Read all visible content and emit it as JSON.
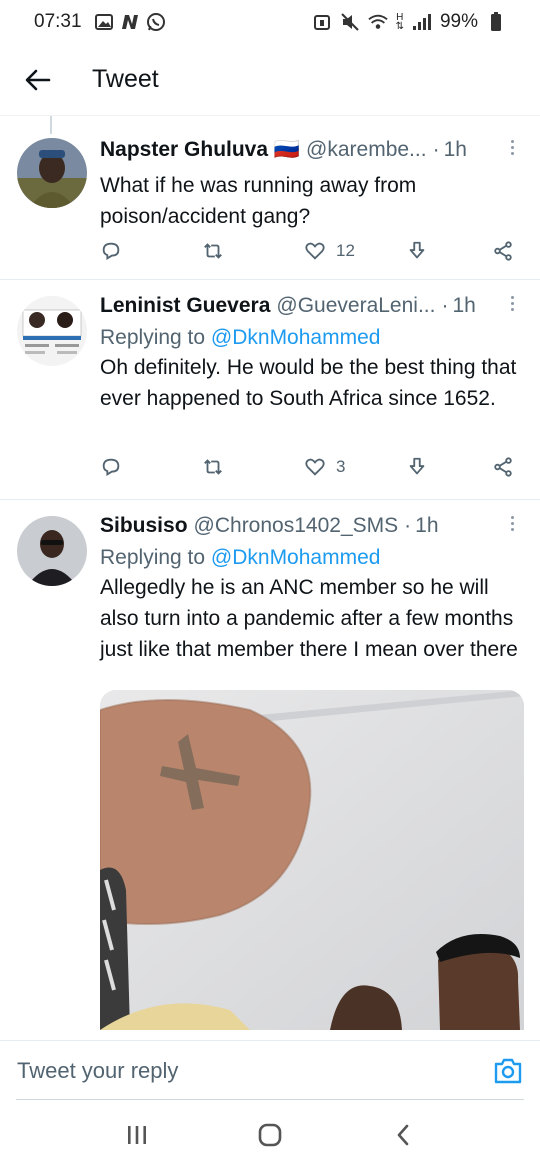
{
  "status_bar": {
    "time": "07:31",
    "battery": "99%",
    "network_label": "H",
    "left_icons": [
      "gallery-icon",
      "n-app-icon",
      "whatsapp-icon"
    ],
    "right_icons": [
      "alarm-icon",
      "mute-icon",
      "wifi-icon",
      "signal-icon",
      "battery-icon"
    ]
  },
  "header": {
    "title": "Tweet"
  },
  "tweets": [
    {
      "name": "Napster Ghuluva 🇷🇺",
      "handle": "@karembe...",
      "time": "1h",
      "text": "What if he was running away from poison/accident gang?",
      "likes": "12",
      "retweets": "",
      "replies": ""
    },
    {
      "name": "Leninist Guevera",
      "handle": "@GueveraLeni...",
      "time": "1h",
      "replying_prefix": "Replying to",
      "replying_to": "@DknMohammed",
      "text": "Oh definitely. He would be the best thing that ever happened to South Africa since 1652.",
      "likes": "3",
      "retweets": "",
      "replies": ""
    },
    {
      "name": "Sibusiso",
      "handle": "@Chronos1402_SMS",
      "time": "1h",
      "replying_prefix": "Replying to",
      "replying_to": "@DknMohammed",
      "text": "Allegedly he is an ANC member so he will also turn into a pandemic after a few months just like that member there I mean over there"
    }
  ],
  "composer": {
    "placeholder": "Tweet your reply"
  },
  "nav": [
    "recents-icon",
    "home-icon",
    "back-icon"
  ],
  "colors": {
    "accent": "#1d9bf0",
    "secondary_text": "#536471"
  }
}
